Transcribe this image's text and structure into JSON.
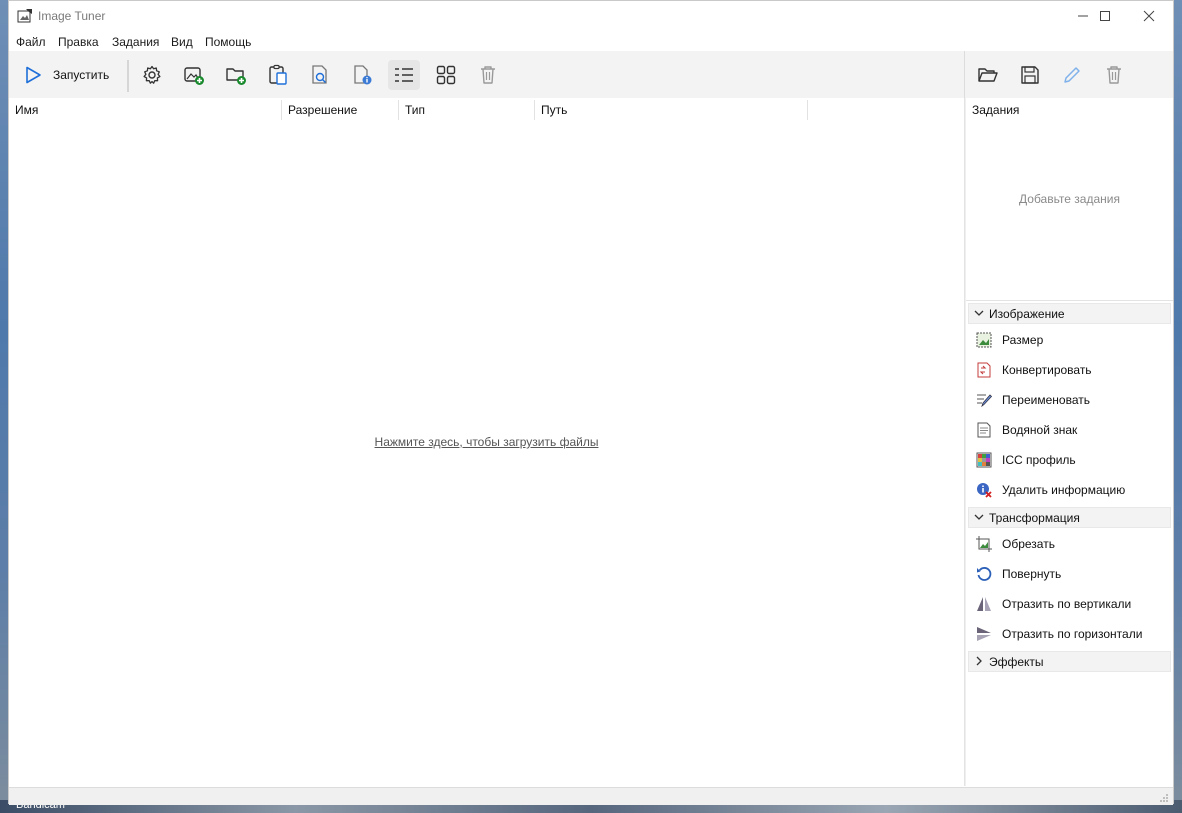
{
  "desktop": {
    "taskbar_label": "Bandicam"
  },
  "window": {
    "title": "Image Tuner"
  },
  "menu": [
    "Файл",
    "Правка",
    "Задания",
    "Вид",
    "Помощь"
  ],
  "toolbar": {
    "run_label": "Запустить"
  },
  "filelist": {
    "columns": [
      "Имя",
      "Разрешение",
      "Тип",
      "Путь"
    ],
    "hint": "Нажмите здесь, чтобы загрузить файлы"
  },
  "tasks": {
    "title": "Задания",
    "empty": "Добавьте задания"
  },
  "groups": [
    {
      "label": "Изображение",
      "expanded": true,
      "items": [
        "Размер",
        "Конвертировать",
        "Переименовать",
        "Водяной знак",
        "ICC профиль",
        "Удалить информацию"
      ]
    },
    {
      "label": "Трансформация",
      "expanded": true,
      "items": [
        "Обрезать",
        "Повернуть",
        "Отразить по вертикали",
        "Отразить по горизонтали"
      ]
    },
    {
      "label": "Эффекты",
      "expanded": false,
      "items": []
    }
  ],
  "colors": {
    "accent": "#1e6fd9",
    "panel_header": "#f3f3f3",
    "toolbar": "#f3f3f3"
  }
}
